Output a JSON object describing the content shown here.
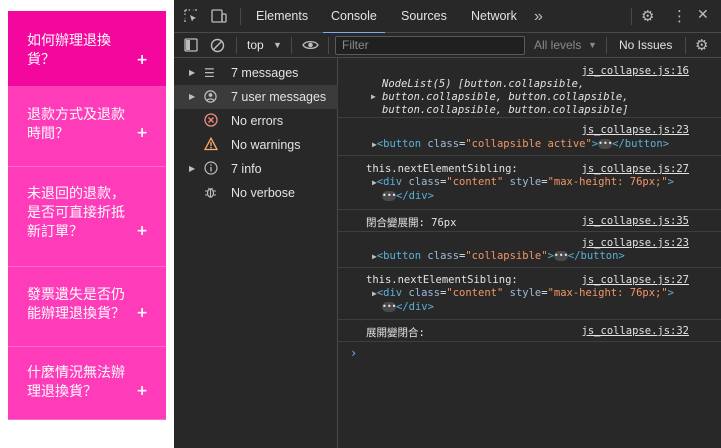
{
  "faq": {
    "items": [
      {
        "question": "如何辦理退換貨？",
        "plus": "+"
      },
      {
        "question": "退款方式及退款時間？",
        "plus": "+"
      },
      {
        "question": "未退回的退款，是否可直接折抵新訂單？",
        "plus": "+"
      },
      {
        "question": "發票遺失是否仍能辦理退換貨？",
        "plus": "+"
      },
      {
        "question": "什麼情況無法辦理退換貨？",
        "plus": "+"
      }
    ]
  },
  "devtools": {
    "tabs": [
      "Elements",
      "Console",
      "Sources",
      "Network"
    ],
    "more_tabs": "»",
    "toolbar": {
      "context": "top",
      "filter_placeholder": "Filter",
      "levels": "All levels",
      "issues": "No Issues"
    },
    "sidebar": [
      {
        "label": "7 messages",
        "icon": "list-icon",
        "expand": true
      },
      {
        "label": "7 user messages",
        "icon": "user-icon",
        "expand": true
      },
      {
        "label": "No errors",
        "icon": "error-icon",
        "expand": false
      },
      {
        "label": "No warnings",
        "icon": "warning-icon",
        "expand": false
      },
      {
        "label": "7 info",
        "icon": "info-icon",
        "expand": true
      },
      {
        "label": "No verbose",
        "icon": "bug-icon",
        "expand": false
      }
    ],
    "messages": {
      "m1": {
        "src": "js_collapse.js:16",
        "l1": "NodeList(5) [button.collapsible,",
        "l2": "button.collapsible, button.collapsible,",
        "l3": "button.collapsible, button.collapsible]"
      },
      "m2": {
        "src": "js_collapse.js:23",
        "tag_open": "<button",
        "attr": "class",
        "val": "\"collapsible active\"",
        "close": "</button>"
      },
      "m3": {
        "label": "this.nextElementSibling:",
        "src": "js_collapse.js:27",
        "tag_open": "<div",
        "attr1": "class",
        "val1": "\"content\"",
        "attr2": "style",
        "val2": "\"max-height: 76px;\"",
        "close": "</div>"
      },
      "m4": {
        "label": "閉合變展開: 76px",
        "src": "js_collapse.js:35"
      },
      "m5": {
        "src": "js_collapse.js:23",
        "tag_open": "<button",
        "attr": "class",
        "val": "\"collapsible\"",
        "close": "</button>"
      },
      "m6": {
        "label": "this.nextElementSibling:",
        "src": "js_collapse.js:27",
        "tag_open": "<div",
        "attr1": "class",
        "val1": "\"content\"",
        "attr2": "style",
        "val2": "\"max-height: 76px;\"",
        "close": "</div>"
      },
      "m7": {
        "label": "展開變閉合:",
        "src": "js_collapse.js:32"
      }
    },
    "prompt": "›"
  }
}
